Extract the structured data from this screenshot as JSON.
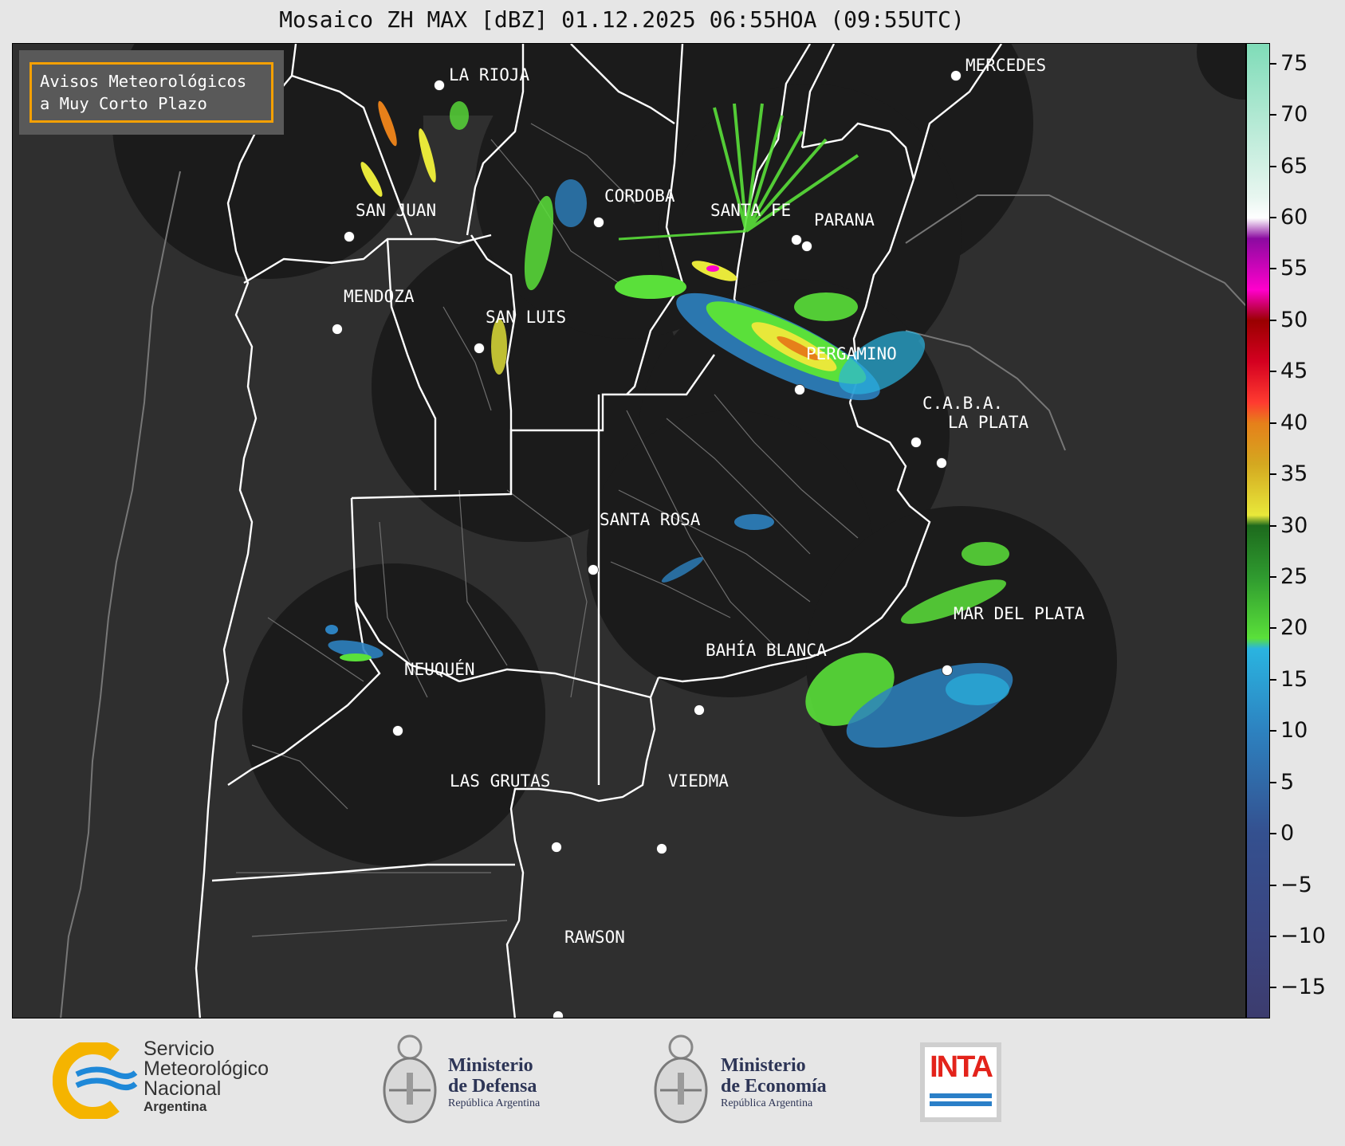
{
  "title": "Mosaico ZH MAX [dBZ] 01.12.2025 06:55HOA (09:55UTC)",
  "avisos": {
    "line1": "Avisos Meteorológicos",
    "line2": "a Muy Corto Plazo",
    "border_color": "#f5a000"
  },
  "cities": [
    {
      "name": "LA RIOJA"
    },
    {
      "name": "MERCEDES"
    },
    {
      "name": "CORDOBA"
    },
    {
      "name": "SAN JUAN"
    },
    {
      "name": "SANTA FE"
    },
    {
      "name": "PARANA"
    },
    {
      "name": "MENDOZA"
    },
    {
      "name": "SAN LUIS"
    },
    {
      "name": "PERGAMINO"
    },
    {
      "name": "C.A.B.A."
    },
    {
      "name": "LA PLATA"
    },
    {
      "name": "SANTA ROSA"
    },
    {
      "name": "MAR DEL PLATA"
    },
    {
      "name": "BAHÍA BLANCA"
    },
    {
      "name": "NEUQUÉN"
    },
    {
      "name": "LAS GRUTAS"
    },
    {
      "name": "VIEDMA"
    },
    {
      "name": "RAWSON"
    }
  ],
  "colorbar": {
    "ticks": [
      "75",
      "70",
      "65",
      "60",
      "55",
      "50",
      "45",
      "40",
      "35",
      "30",
      "25",
      "20",
      "15",
      "10",
      "5",
      "0",
      "−5",
      "−10",
      "−15"
    ],
    "range": [
      -18,
      77
    ],
    "stops": [
      {
        "value": 77,
        "color": "#7fdcb8"
      },
      {
        "value": 62,
        "color": "#e8f6f0"
      },
      {
        "value": 60,
        "color": "#ffffff"
      },
      {
        "value": 58,
        "color": "#8b0aa0"
      },
      {
        "value": 53,
        "color": "#ff00cc"
      },
      {
        "value": 50,
        "color": "#9a0000"
      },
      {
        "value": 46,
        "color": "#d40020"
      },
      {
        "value": 42,
        "color": "#ff3b30"
      },
      {
        "value": 40,
        "color": "#e6801a"
      },
      {
        "value": 36,
        "color": "#d4a820"
      },
      {
        "value": 31,
        "color": "#e8e83a"
      },
      {
        "value": 30,
        "color": "#1d6a1d"
      },
      {
        "value": 25,
        "color": "#2f9a2f"
      },
      {
        "value": 19,
        "color": "#5ae03a"
      },
      {
        "value": 18,
        "color": "#2ab4e0"
      },
      {
        "value": 10,
        "color": "#2d82c0"
      },
      {
        "value": 0,
        "color": "#34508f"
      },
      {
        "value": -10,
        "color": "#3b4580"
      },
      {
        "value": -18,
        "color": "#3c3c6e"
      }
    ]
  },
  "logos": {
    "smn": {
      "line1": "Servicio",
      "line2": "Meteorológico",
      "line3": "Nacional",
      "line4": "Argentina"
    },
    "defensa": {
      "line1": "Ministerio",
      "line2": "de Defensa",
      "line3": "República Argentina"
    },
    "economia": {
      "line1": "Ministerio",
      "line2": "de Economía",
      "line3": "República Argentina"
    },
    "inta": {
      "text": "INTA"
    }
  }
}
